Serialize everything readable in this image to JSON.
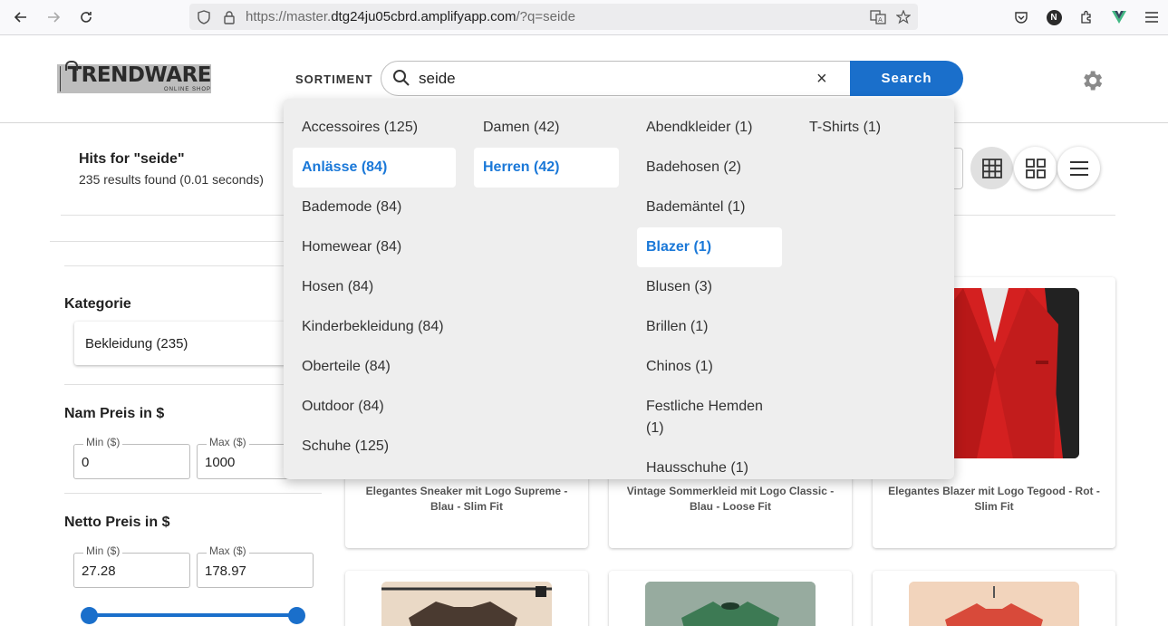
{
  "browser": {
    "url_prefix": "https://master.",
    "url_host": "dtg24ju05cbrd.amplifyapp.com",
    "url_suffix": "/?q=seide",
    "profile_initial": "N"
  },
  "header": {
    "logo_main": "TRENDWARE",
    "logo_sub": "ONLINE SHOP",
    "sortiment_label": "SORTIMENT",
    "search_value": "seide",
    "search_button": "Search",
    "clear_symbol": "×"
  },
  "results": {
    "title": "Hits for \"seide\"",
    "subtitle": "235 results found (0.01 seconds)"
  },
  "facets": {
    "category_title": "Kategorie",
    "category_item": "Bekleidung (235)",
    "nam_price_title": "Nam Preis in $",
    "nam_min_label": "Min ($)",
    "nam_min_value": "0",
    "nam_max_label": "Max ($)",
    "nam_max_value": "1000",
    "netto_price_title": "Netto Preis in $",
    "netto_min_label": "Min ($)",
    "netto_min_value": "27.28",
    "netto_max_label": "Max ($)",
    "netto_max_value": "178.97"
  },
  "dropdown": {
    "col1": [
      "Accessoires (125)",
      "Anlässe (84)",
      "Bademode (84)",
      "Homewear (84)",
      "Hosen (84)",
      "Kinderbekleidung (84)",
      "Oberteile (84)",
      "Outdoor (84)",
      "Schuhe (125)"
    ],
    "col2": [
      "Damen (42)",
      "Herren (42)"
    ],
    "col3": [
      "Abendkleider (1)",
      "Badehosen (2)",
      "Bademäntel (1)",
      "Blazer (1)",
      "Blusen (3)",
      "Brillen (1)",
      "Chinos (1)",
      "Festliche Hemden",
      "(1)",
      "Hausschuhe (1)"
    ],
    "col4": [
      "T-Shirts (1)"
    ]
  },
  "products": [
    {
      "name_line1": "Elegantes Sneaker mit Logo Supreme -",
      "name_line2": "Blau - Slim Fit"
    },
    {
      "name_line1": "Vintage Sommerkleid mit Logo Classic -",
      "name_line2": "Blau - Loose Fit"
    },
    {
      "name_line1": "Elegantes Blazer mit Logo Tegood - Rot -",
      "name_line2": "Slim Fit"
    }
  ],
  "colors": {
    "accent": "#1a6fcb",
    "selected_text": "#1a78d8",
    "dropdown_bg": "#eeeeee"
  }
}
